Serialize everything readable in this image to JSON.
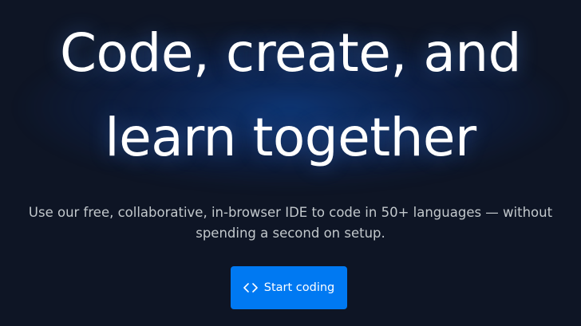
{
  "hero": {
    "headline_line1": "Code, create, and",
    "headline_line2": "learn together",
    "subtitle_line1": "Use our free, collaborative, in-browser IDE to code in 50+ languages — without",
    "subtitle_line2": "spending a second on setup."
  },
  "cta": {
    "label": "Start coding",
    "icon": "code-brackets-icon",
    "color": "#0079f2"
  },
  "colors": {
    "background": "#0e1525",
    "headline": "#ffffff",
    "subtitle": "#c2c8cc"
  }
}
